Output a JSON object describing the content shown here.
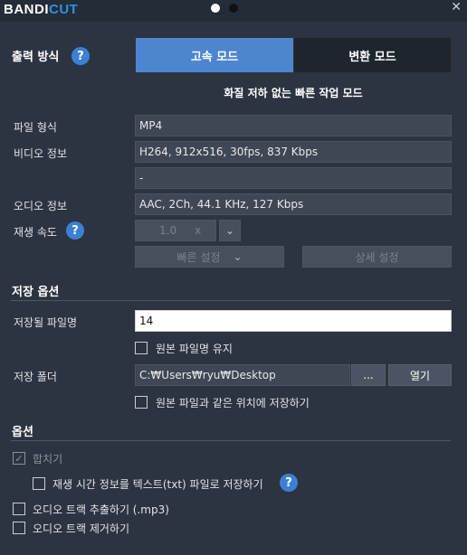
{
  "app": {
    "logo_prefix": "BANDI",
    "logo_accent": "CUT",
    "close_glyph": "✕"
  },
  "output": {
    "title": "출력 방식",
    "help": "?",
    "mode_fast": "고속 모드",
    "mode_convert": "변환 모드",
    "mode_description": "화질 저하 없는 빠른 작업 모드",
    "selected_mode": "고속 모드"
  },
  "info": {
    "file_format_label": "파일 형식",
    "file_format_value": "MP4",
    "video_info_label": "비디오 정보",
    "video_info_value": "H264, 912x516, 30fps, 837 Kbps",
    "video_info_extra": "-",
    "audio_info_label": "오디오 정보",
    "audio_info_value": "AAC, 2Ch, 44.1 KHz, 127 Kbps",
    "speed_label": "재생 속도",
    "speed_help": "?",
    "speed_value": "1.0",
    "speed_unit": "x",
    "speed_dropdown": "⌄",
    "quick_settings": "빠른 설정",
    "detail_settings": "상세 설정"
  },
  "save": {
    "title": "저장 옵션",
    "filename_label": "저장될 파일명",
    "filename_value": "14",
    "keep_original_name": "원본 파일명 유지",
    "folder_label": "저장 폴더",
    "folder_value": "C:₩Users₩ryu₩Desktop",
    "browse_button": "...",
    "open_button": "열기",
    "save_same_location": "원본 파일과 같은 위치에 저장하기"
  },
  "options": {
    "title": "옵션",
    "merge": "합치기",
    "save_timeline_txt": "재생 시간 정보를 텍스트(txt) 파일로 저장하기",
    "timeline_help": "?",
    "extract_audio": "오디오 트랙 추출하기 (.mp3)",
    "remove_audio": "오디오 트랙 제거하기"
  },
  "colors": {
    "background": "#2b3440",
    "accent": "#4d86cf",
    "help_icon": "#3d7fd3"
  }
}
